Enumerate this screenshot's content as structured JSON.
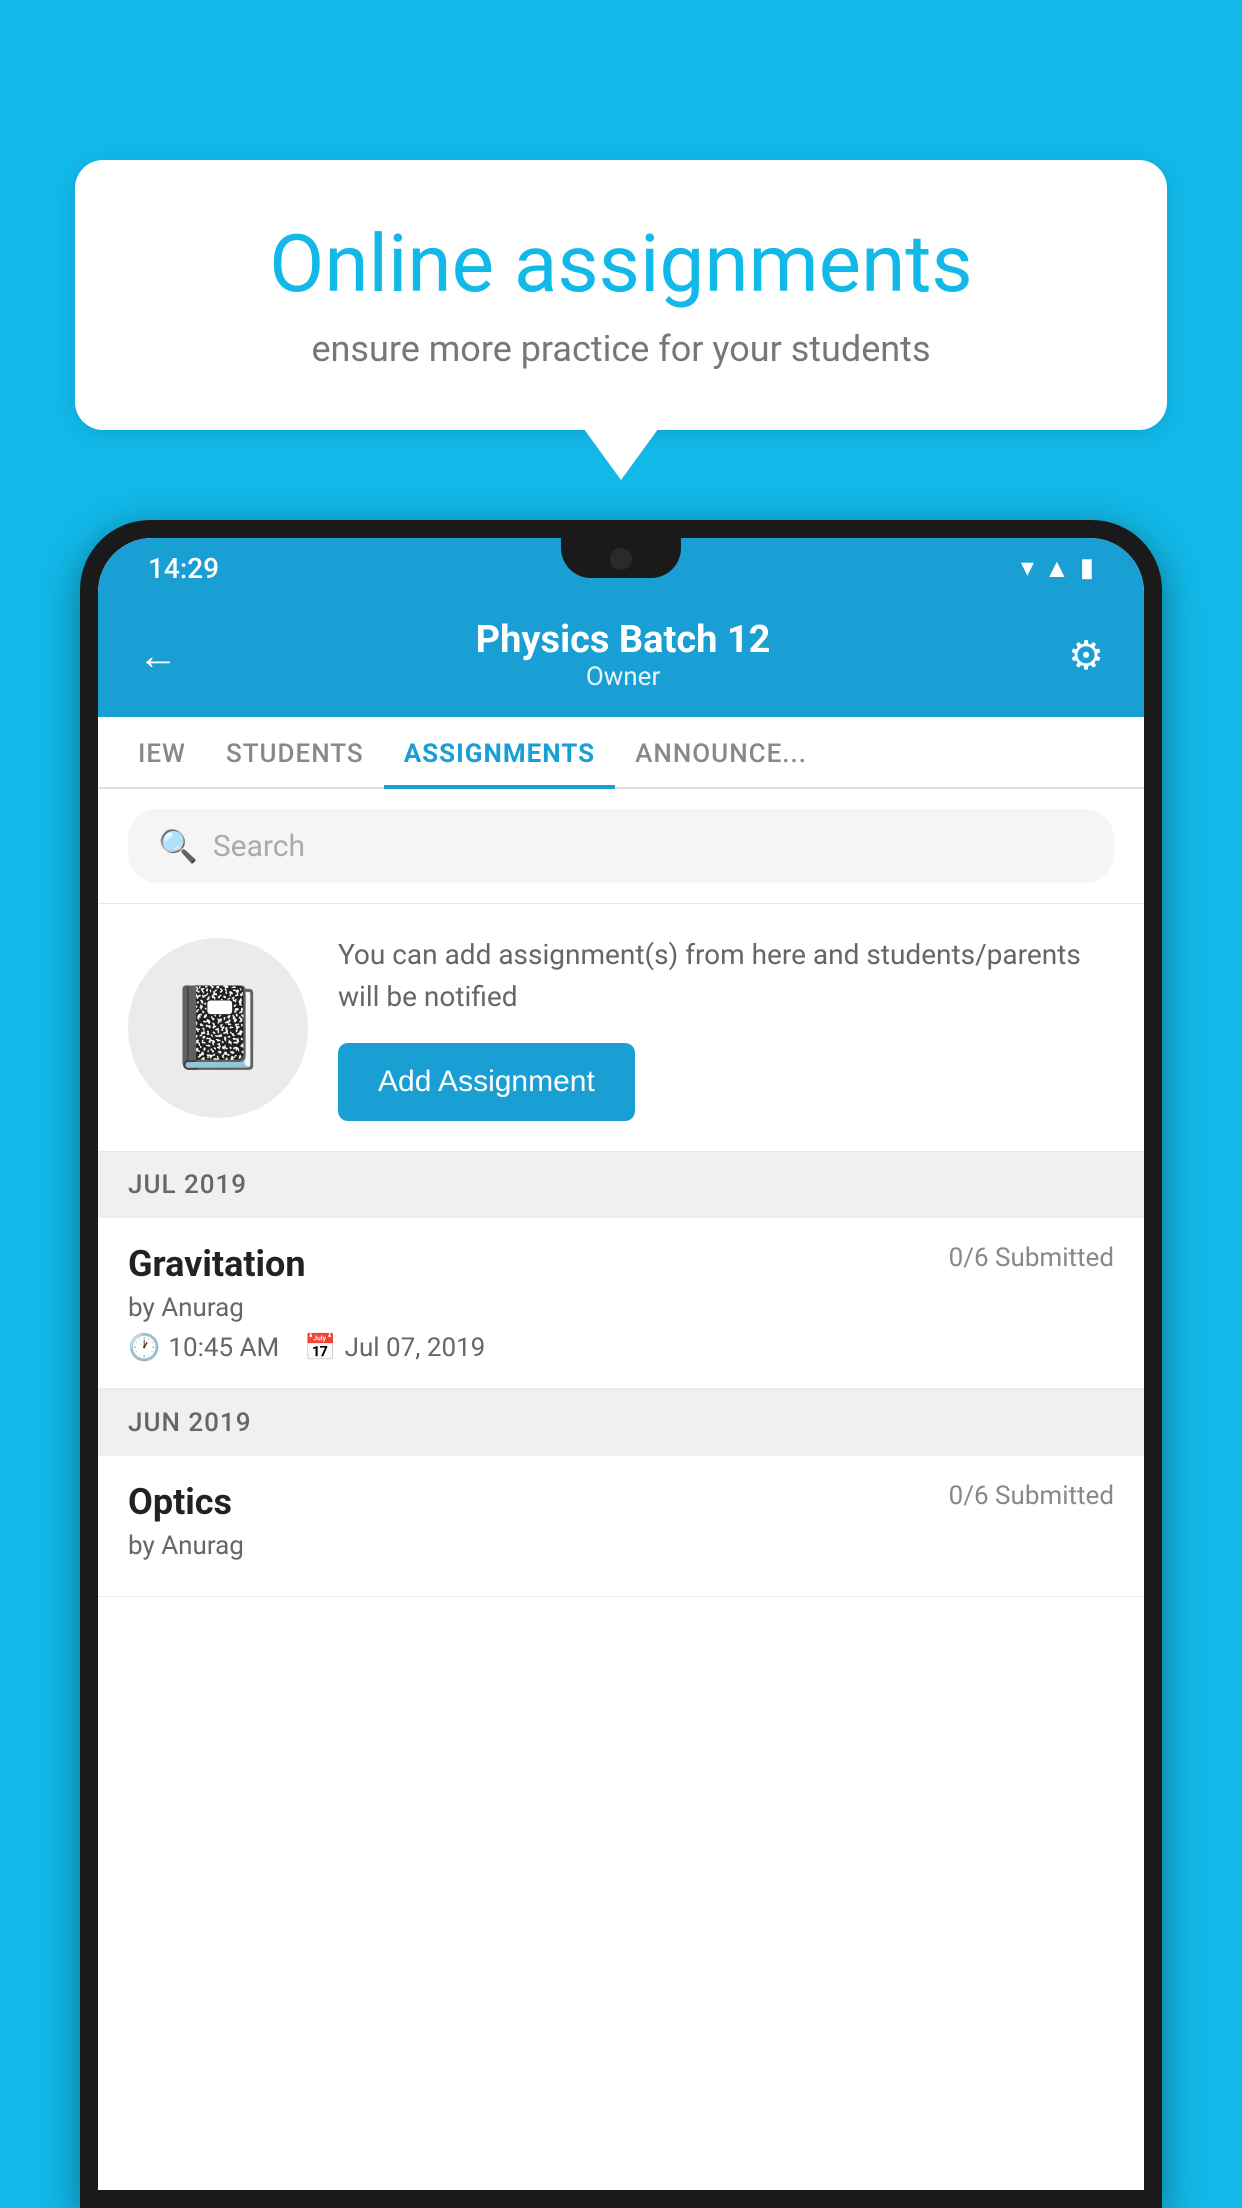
{
  "background_color": "#12b8e8",
  "speech_bubble": {
    "title": "Online assignments",
    "subtitle": "ensure more practice for your students"
  },
  "status_bar": {
    "time": "14:29",
    "icons": [
      "wifi",
      "signal",
      "battery"
    ]
  },
  "app_header": {
    "title": "Physics Batch 12",
    "subtitle": "Owner",
    "back_label": "←",
    "settings_label": "⚙"
  },
  "tabs": [
    {
      "label": "IEW",
      "active": false
    },
    {
      "label": "STUDENTS",
      "active": false
    },
    {
      "label": "ASSIGNMENTS",
      "active": true
    },
    {
      "label": "ANNOUNCEMENTS",
      "active": false
    }
  ],
  "search": {
    "placeholder": "Search"
  },
  "empty_state": {
    "description": "You can add assignment(s) from here and students/parents will be notified",
    "button_label": "Add Assignment"
  },
  "sections": [
    {
      "label": "JUL 2019",
      "assignments": [
        {
          "name": "Gravitation",
          "submitted": "0/6 Submitted",
          "author": "by Anurag",
          "time": "10:45 AM",
          "date": "Jul 07, 2019"
        }
      ]
    },
    {
      "label": "JUN 2019",
      "assignments": [
        {
          "name": "Optics",
          "submitted": "0/6 Submitted",
          "author": "by Anurag",
          "time": "",
          "date": ""
        }
      ]
    }
  ]
}
